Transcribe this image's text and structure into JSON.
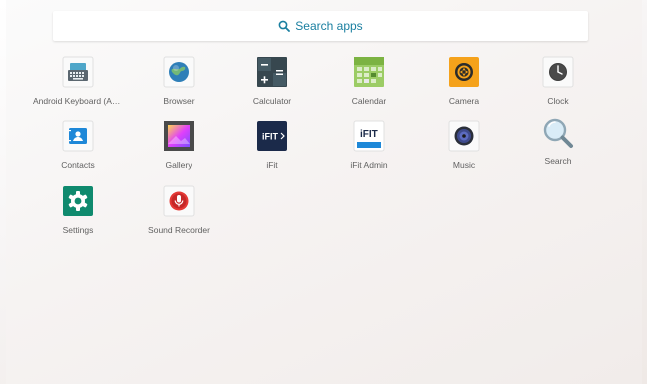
{
  "search": {
    "label": "Search apps"
  },
  "apps": [
    {
      "label": "Android Keyboard (AO...",
      "icon": "keyboard-icon"
    },
    {
      "label": "Browser",
      "icon": "globe-icon"
    },
    {
      "label": "Calculator",
      "icon": "calculator-icon"
    },
    {
      "label": "Calendar",
      "icon": "calendar-icon"
    },
    {
      "label": "Camera",
      "icon": "camera-icon"
    },
    {
      "label": "Clock",
      "icon": "clock-icon"
    },
    {
      "label": "Contacts",
      "icon": "contacts-icon"
    },
    {
      "label": "Gallery",
      "icon": "gallery-icon"
    },
    {
      "label": "iFit",
      "icon": "ifit-icon",
      "logo_text": "iFIT"
    },
    {
      "label": "iFit Admin",
      "icon": "ifit-admin-icon",
      "logo_text": "iFIT"
    },
    {
      "label": "Music",
      "icon": "music-icon"
    },
    {
      "label": "Search",
      "icon": "magnifier-icon"
    },
    {
      "label": "Settings",
      "icon": "settings-gear-icon"
    },
    {
      "label": "Sound Recorder",
      "icon": "microphone-icon"
    }
  ],
  "colors": {
    "accent": "#1a7fa0",
    "label": "#616161",
    "camera": "#f5a21b",
    "settings": "#0f8a6e",
    "ifit": "#1b2a4a",
    "recorder": "#d32f2f"
  }
}
